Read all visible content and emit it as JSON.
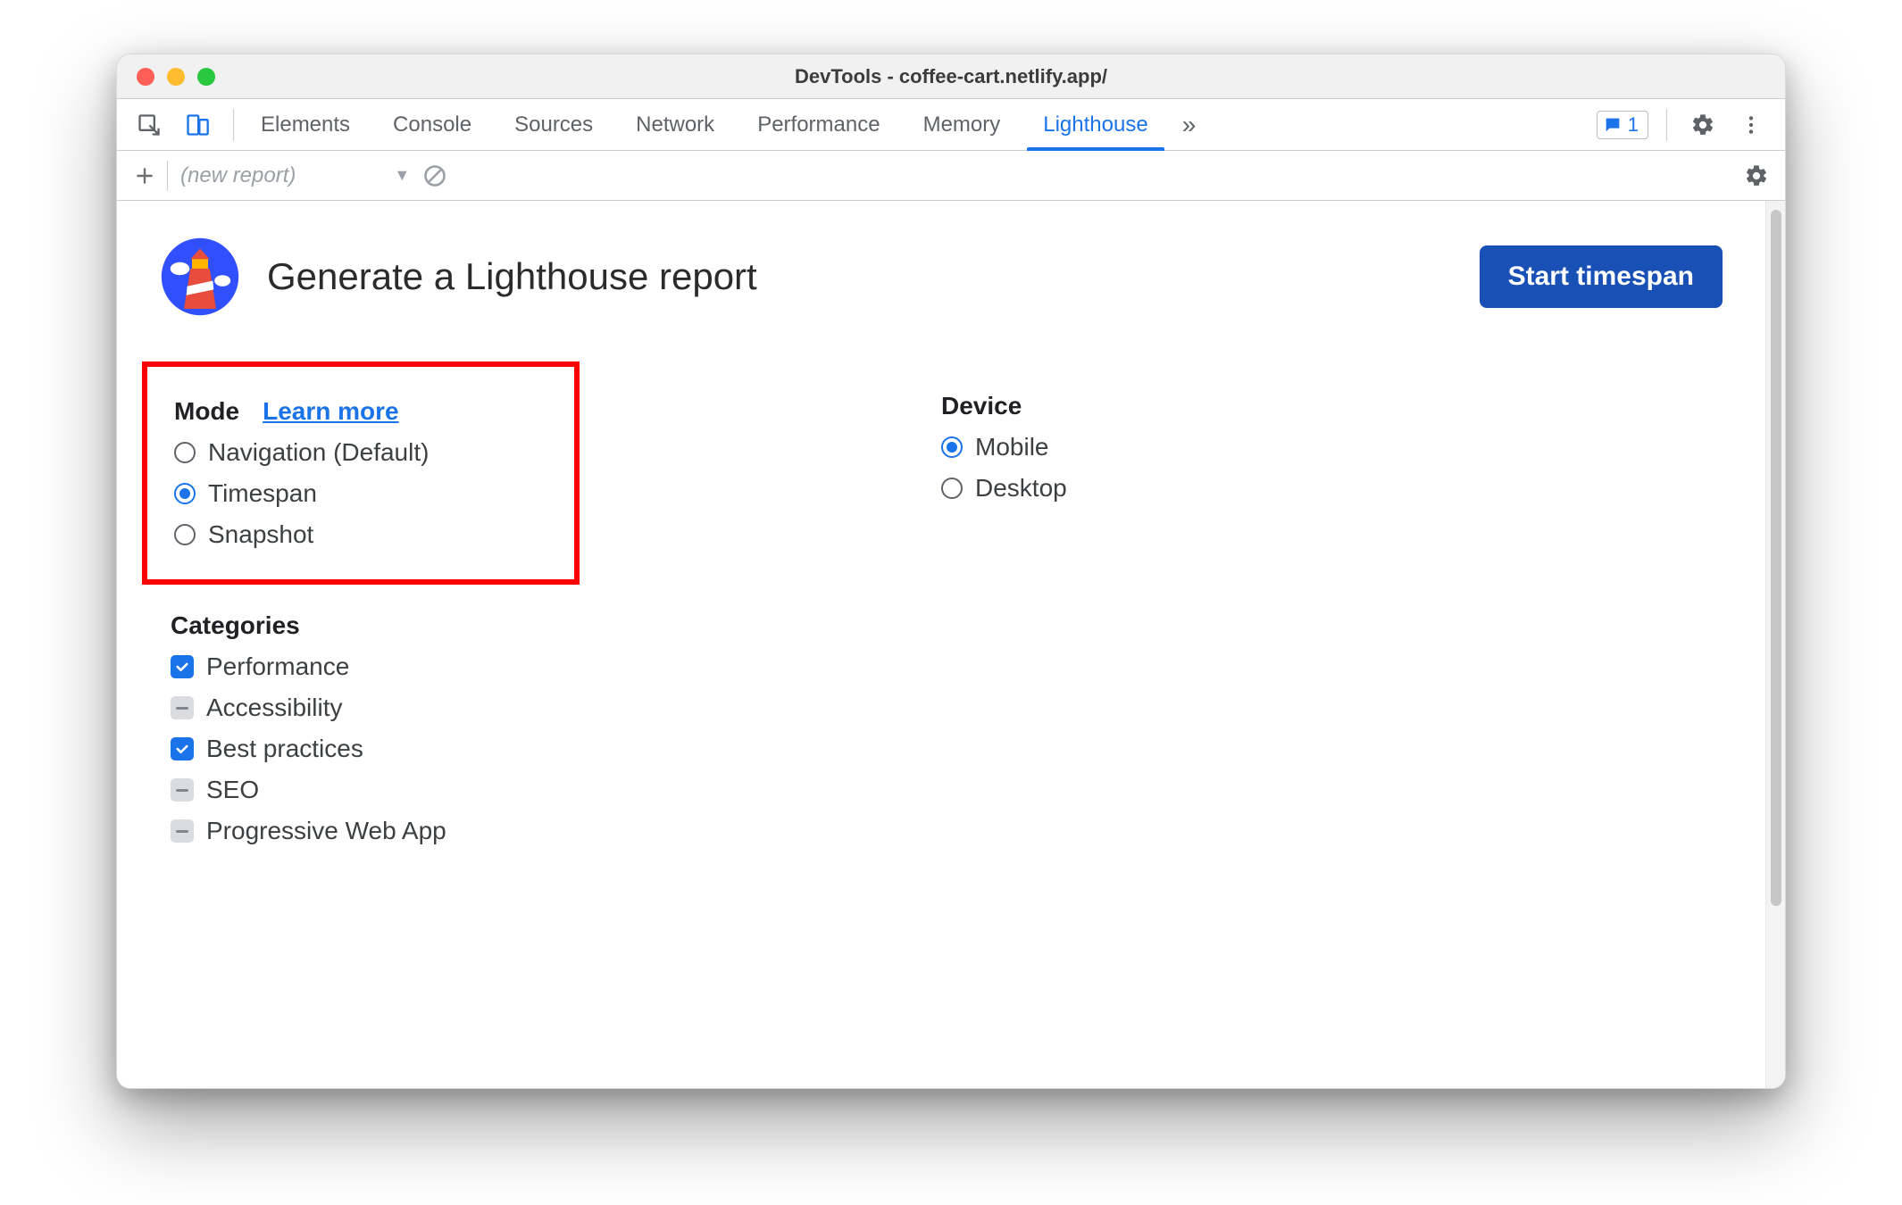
{
  "window": {
    "title": "DevTools - coffee-cart.netlify.app/"
  },
  "tabs": {
    "items": [
      "Elements",
      "Console",
      "Sources",
      "Network",
      "Performance",
      "Memory",
      "Lighthouse"
    ],
    "active": "Lighthouse",
    "more_glyph": "»",
    "badge_count": "1"
  },
  "subbar": {
    "report_label": "(new report)"
  },
  "header": {
    "title": "Generate a Lighthouse report",
    "button": "Start timespan"
  },
  "mode": {
    "heading": "Mode",
    "learn_more": "Learn more",
    "options": [
      {
        "label": "Navigation (Default)",
        "checked": false
      },
      {
        "label": "Timespan",
        "checked": true
      },
      {
        "label": "Snapshot",
        "checked": false
      }
    ]
  },
  "device": {
    "heading": "Device",
    "options": [
      {
        "label": "Mobile",
        "checked": true
      },
      {
        "label": "Desktop",
        "checked": false
      }
    ]
  },
  "categories": {
    "heading": "Categories",
    "options": [
      {
        "label": "Performance",
        "state": "checked"
      },
      {
        "label": "Accessibility",
        "state": "indeterminate"
      },
      {
        "label": "Best practices",
        "state": "checked"
      },
      {
        "label": "SEO",
        "state": "indeterminate"
      },
      {
        "label": "Progressive Web App",
        "state": "indeterminate"
      }
    ]
  }
}
